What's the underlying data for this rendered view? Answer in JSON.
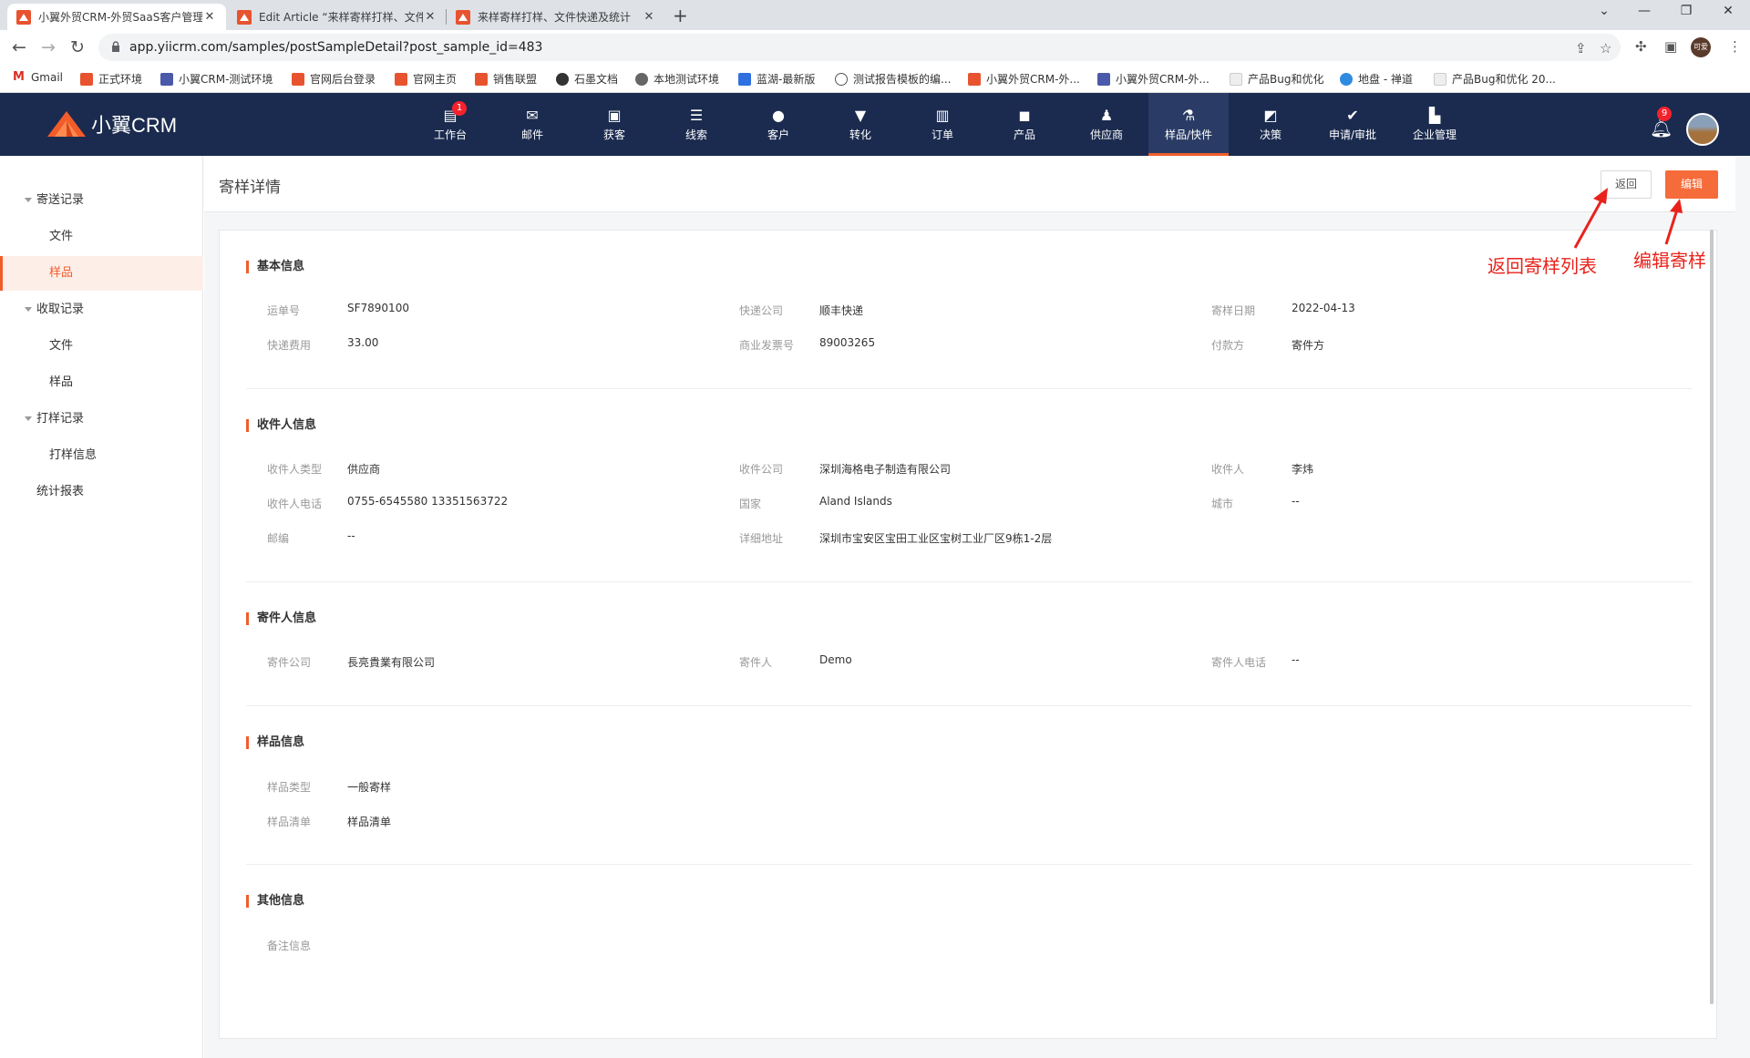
{
  "browser": {
    "tabs": [
      {
        "title": "小翼外贸CRM-外贸SaaS客户管理"
      },
      {
        "title": "Edit Article “来样寄样打样、文件"
      },
      {
        "title": "来样寄样打样、文件快递及统计"
      }
    ],
    "url": "app.yiicrm.com/samples/postSampleDetail?post_sample_id=483",
    "profile_label": "可爱",
    "bookmarks": [
      {
        "label": "Gmail"
      },
      {
        "label": "正式环境"
      },
      {
        "label": "小翼CRM-测试环境"
      },
      {
        "label": "官网后台登录"
      },
      {
        "label": "官网主页"
      },
      {
        "label": "销售联盟"
      },
      {
        "label": "石墨文档"
      },
      {
        "label": "本地测试环境"
      },
      {
        "label": "蓝湖-最新版"
      },
      {
        "label": "测试报告模板的编..."
      },
      {
        "label": "小翼外贸CRM-外..."
      },
      {
        "label": "小翼外贸CRM-外..."
      },
      {
        "label": "产品Bug和优化"
      },
      {
        "label": "地盘 - 禅道"
      },
      {
        "label": "产品Bug和优化 20..."
      }
    ]
  },
  "app": {
    "logo_text": "小翼CRM",
    "nav": [
      {
        "label": "工作台",
        "icon": "dashboard-icon",
        "badge": "1"
      },
      {
        "label": "邮件",
        "icon": "mail-icon"
      },
      {
        "label": "获客",
        "icon": "acquire-icon"
      },
      {
        "label": "线索",
        "icon": "lead-icon"
      },
      {
        "label": "客户",
        "icon": "customer-icon"
      },
      {
        "label": "转化",
        "icon": "funnel-icon"
      },
      {
        "label": "订单",
        "icon": "order-icon"
      },
      {
        "label": "产品",
        "icon": "product-icon"
      },
      {
        "label": "供应商",
        "icon": "supplier-icon"
      },
      {
        "label": "样品/快件",
        "icon": "flask-icon",
        "active": true
      },
      {
        "label": "决策",
        "icon": "chart-icon"
      },
      {
        "label": "申请/审批",
        "icon": "approval-icon"
      },
      {
        "label": "企业管理",
        "icon": "building-icon"
      }
    ],
    "notification_count": "9",
    "colors": {
      "accent": "#f25c2a",
      "nav_bg": "#1b2b4f"
    }
  },
  "sidebar": {
    "groups": [
      {
        "label": "寄送记录",
        "children": [
          "文件",
          "样品"
        ]
      },
      {
        "label": "收取记录",
        "children": [
          "文件",
          "样品"
        ]
      },
      {
        "label": "打样记录",
        "children": [
          "打样信息"
        ]
      }
    ],
    "report": "统计报表",
    "selected": "样品"
  },
  "page": {
    "title": "寄样详情",
    "back_label": "返回",
    "edit_label": "编辑",
    "annotations": {
      "back": "返回寄样列表",
      "edit": "编辑寄样"
    },
    "sections": {
      "basic": {
        "title": "基本信息",
        "fields": [
          {
            "label": "运单号",
            "value": "SF7890100"
          },
          {
            "label": "快递公司",
            "value": "顺丰快递"
          },
          {
            "label": "寄样日期",
            "value": "2022-04-13"
          },
          {
            "label": "快递费用",
            "value": "33.00"
          },
          {
            "label": "商业发票号",
            "value": "89003265"
          },
          {
            "label": "付款方",
            "value": "寄件方"
          }
        ]
      },
      "recipient": {
        "title": "收件人信息",
        "fields": [
          {
            "label": "收件人类型",
            "value": "供应商"
          },
          {
            "label": "收件公司",
            "value": "深圳海格电子制造有限公司"
          },
          {
            "label": "收件人",
            "value": "李炜"
          },
          {
            "label": "收件人电话",
            "value": "0755-6545580 13351563722"
          },
          {
            "label": "国家",
            "value": "Aland Islands"
          },
          {
            "label": "城市",
            "value": "--"
          },
          {
            "label": "邮编",
            "value": "--"
          },
          {
            "label": "详细地址",
            "value": "深圳市宝安区宝田工业区宝树工业厂区9栋1-2层"
          }
        ]
      },
      "sender": {
        "title": "寄件人信息",
        "fields": [
          {
            "label": "寄件公司",
            "value": "長亮貴業有限公司"
          },
          {
            "label": "寄件人",
            "value": "Demo"
          },
          {
            "label": "寄件人电话",
            "value": "--"
          }
        ]
      },
      "sample": {
        "title": "样品信息",
        "fields": [
          {
            "label": "样品类型",
            "value": "一般寄样"
          },
          {
            "label": "样品清单",
            "value": "样品清单"
          }
        ]
      },
      "other": {
        "title": "其他信息",
        "fields": [
          {
            "label": "备注信息",
            "value": ""
          }
        ]
      }
    }
  }
}
